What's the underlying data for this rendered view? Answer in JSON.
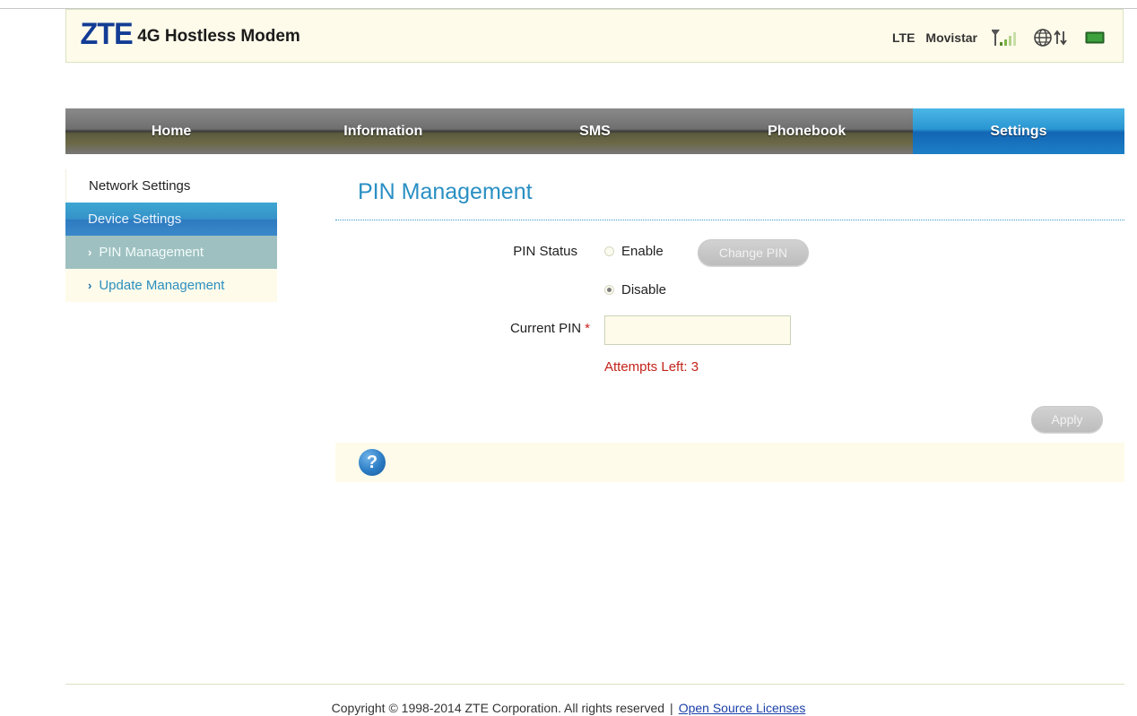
{
  "header": {
    "logo": "ZTE",
    "product_title": "4G Hostless Modem",
    "network_type": "LTE",
    "carrier": "Movistar",
    "signal_icon": "signal-strength-icon",
    "connection_icon": "globe-data-icon",
    "battery_icon": "battery-icon"
  },
  "nav": {
    "items": [
      "Home",
      "Information",
      "SMS",
      "Phonebook",
      "Settings"
    ],
    "active": "Settings"
  },
  "sidebar": {
    "groups": [
      {
        "label": "Network Settings"
      },
      {
        "label": "Device Settings"
      }
    ],
    "items": [
      {
        "label": "PIN Management",
        "selected": true
      },
      {
        "label": "Update Management",
        "selected": false
      }
    ]
  },
  "main": {
    "title": "PIN Management",
    "pin_status_label": "PIN Status",
    "enable_label": "Enable",
    "disable_label": "Disable",
    "selected_status": "Disable",
    "change_pin_label": "Change PIN",
    "current_pin_label": "Current PIN",
    "required_mark": "*",
    "current_pin_value": "",
    "attempts_text": "Attempts Left: 3",
    "apply_label": "Apply",
    "help_symbol": "?"
  },
  "footer": {
    "copyright": "Copyright © 1998-2014 ZTE Corporation. All rights reserved",
    "separator": "|",
    "link_text": "Open Source Licenses"
  },
  "colors": {
    "accent_blue": "#2a8fc3",
    "nav_active": "#1c7fc6",
    "error_red": "#c3231a",
    "panel_bg": "#fffbea"
  }
}
